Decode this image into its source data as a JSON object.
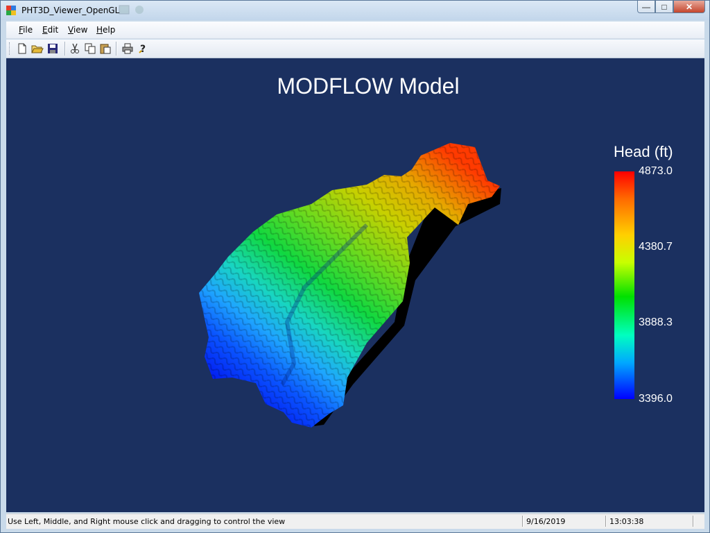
{
  "window": {
    "title": "PHT3D_Viewer_OpenGL",
    "minimize_label": "—",
    "maximize_label": "□",
    "close_label": "✕"
  },
  "menu": {
    "items": [
      {
        "label": "File",
        "accel": "F"
      },
      {
        "label": "Edit",
        "accel": "E"
      },
      {
        "label": "View",
        "accel": "V"
      },
      {
        "label": "Help",
        "accel": "H"
      }
    ]
  },
  "toolbar": {
    "buttons": [
      "new-file-icon",
      "open-folder-icon",
      "save-icon",
      "cut-icon",
      "copy-icon",
      "paste-icon",
      "print-icon",
      "help-icon"
    ]
  },
  "viewport": {
    "title": "MODFLOW Model",
    "background": "#1b3060"
  },
  "legend": {
    "title": "Head (ft)",
    "ticks": [
      "4873.0",
      "4380.7",
      "3888.3",
      "3396.0"
    ],
    "max": 4873.0,
    "min": 3396.0
  },
  "status": {
    "message": "Use Left, Middle, and Right mouse click and dragging to control the view",
    "date": "9/16/2019",
    "time": "13:03:38"
  }
}
